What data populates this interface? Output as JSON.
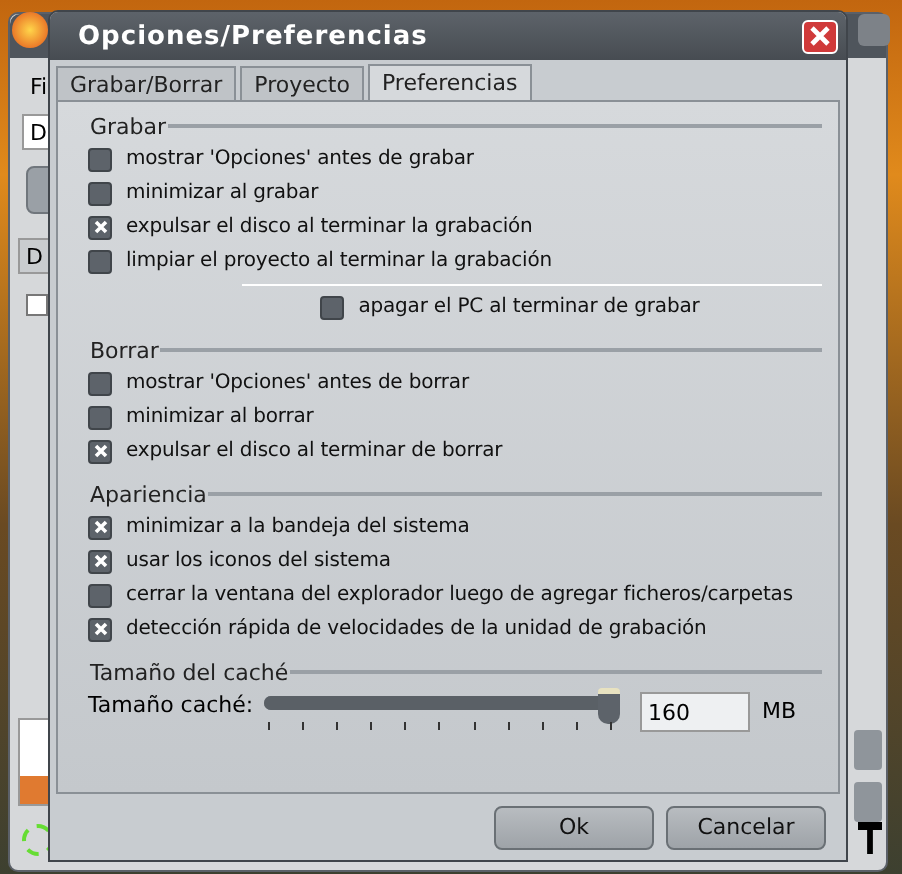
{
  "background_window": {
    "menu_text": "Fi",
    "field_text": "D",
    "column_text": "D"
  },
  "dialog": {
    "title": "Opciones/Preferencias"
  },
  "tabs": [
    {
      "label": "Grabar/Borrar",
      "selected": false
    },
    {
      "label": "Proyecto",
      "selected": false
    },
    {
      "label": "Preferencias",
      "selected": true
    }
  ],
  "sections": [
    {
      "title": "Grabar",
      "options": [
        {
          "label": "mostrar 'Opciones' antes de grabar",
          "checked": false
        },
        {
          "label": "minimizar al grabar",
          "checked": false
        },
        {
          "label": "expulsar el disco al terminar la grabación",
          "checked": true
        },
        {
          "label": "limpiar el proyecto al terminar la grabación",
          "checked": false
        }
      ],
      "extra_option": {
        "label": "apagar el PC al terminar de grabar",
        "checked": false
      }
    },
    {
      "title": "Borrar",
      "options": [
        {
          "label": "mostrar 'Opciones' antes de borrar",
          "checked": false
        },
        {
          "label": "minimizar al borrar",
          "checked": false
        },
        {
          "label": "expulsar el disco al terminar de borrar",
          "checked": true
        }
      ]
    },
    {
      "title": "Apariencia",
      "options": [
        {
          "label": "minimizar a la bandeja del sistema",
          "checked": true
        },
        {
          "label": "usar los iconos del sistema",
          "checked": true
        },
        {
          "label": "cerrar la ventana del explorador luego de agregar ficheros/carpetas",
          "checked": false
        },
        {
          "label": "detección rápida de velocidades de la unidad de grabación",
          "checked": true
        }
      ]
    }
  ],
  "cache": {
    "title": "Tamaño del caché",
    "label": "Tamaño caché:",
    "level": 1,
    "value": "160",
    "unit": "MB"
  },
  "buttons": [
    "Ok",
    "Cancelar"
  ]
}
